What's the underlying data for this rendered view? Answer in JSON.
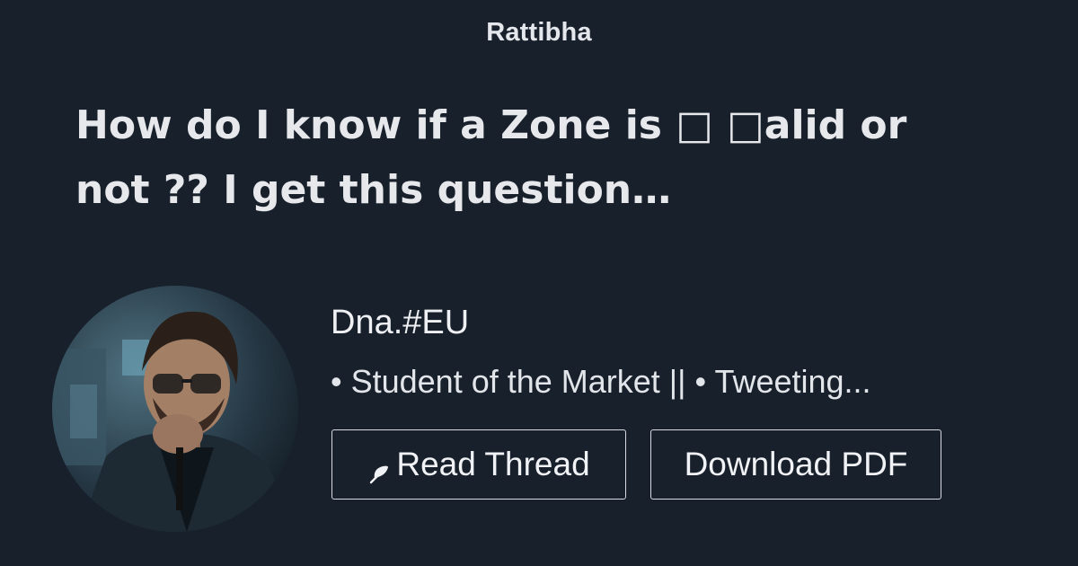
{
  "site": {
    "brand": "Rattibha"
  },
  "thread": {
    "title": "How do I know if a Zone is □ □alid or not ?? I get this question…"
  },
  "author": {
    "name": "Dna.#EU",
    "bio": "• Student of the Market || • Tweeting...",
    "avatar_icon": "profile-photo"
  },
  "actions": {
    "read_label": "Read Thread",
    "read_icon": "feather-icon",
    "pdf_label": "Download PDF"
  },
  "colors": {
    "background": "#18202b",
    "text": "#e6e8ec",
    "button_border": "#d6dae0"
  }
}
